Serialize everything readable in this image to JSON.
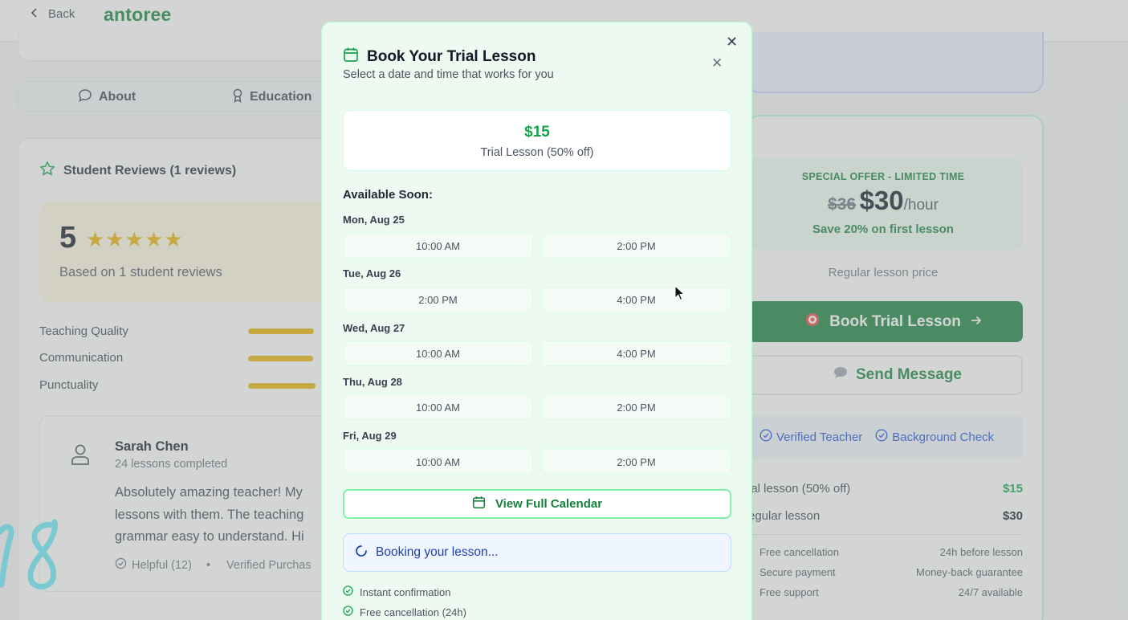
{
  "header": {
    "back_label": "Back",
    "brand": "antoree"
  },
  "tabs": [
    {
      "label": "About"
    },
    {
      "label": "Education"
    }
  ],
  "reviews": {
    "title": "Student Reviews (1 reviews)",
    "rating": "5",
    "stars": 5,
    "based_on": "Based on 1 student reviews",
    "metrics": [
      {
        "label": "Teaching Quality",
        "score_fraction": 1
      },
      {
        "label": "Communication",
        "score_fraction": 1
      },
      {
        "label": "Punctuality",
        "score_fraction": 1
      }
    ],
    "review": {
      "name": "Sarah Chen",
      "lessons": "24 lessons completed",
      "lines": [
        "Absolutely amazing teacher! My",
        "lessons with them. The teaching",
        "grammar easy to understand. Hi"
      ],
      "helpful": "Helpful (12)",
      "bullet": "•",
      "verified": "Verified Purchas"
    }
  },
  "pricing": {
    "offer_label": "SPECIAL OFFER - LIMITED TIME",
    "old_price": "$36",
    "new_price": "$30",
    "per_hour": "/hour",
    "save_text": "Save 20% on first lesson",
    "regular_label": "Regular lesson price",
    "book_label": "Book Trial Lesson",
    "message_label": "Send Message",
    "badges": [
      "Verified Teacher",
      "Background Check"
    ],
    "rows": [
      {
        "label": "ial lesson (50% off)",
        "value": "$15",
        "value_color": "#16a34a"
      },
      {
        "label": "egular lesson",
        "value": "$30",
        "value_color": "#111827"
      }
    ],
    "features": [
      {
        "label": "Free cancellation",
        "value": "24h before lesson"
      },
      {
        "label": "Secure payment",
        "value": "Money-back guarantee"
      },
      {
        "label": "Free support",
        "value": "24/7 available"
      }
    ]
  },
  "modal": {
    "title": "Book Your Trial Lesson",
    "subtitle": "Select a date and time that works for you",
    "price": "$15",
    "price_desc": "Trial Lesson (50% off)",
    "available_title": "Available Soon:",
    "days": [
      {
        "label": "Mon, Aug 25",
        "slots": [
          "10:00 AM",
          "2:00 PM"
        ]
      },
      {
        "label": "Tue, Aug 26",
        "slots": [
          "2:00 PM",
          "4:00 PM"
        ]
      },
      {
        "label": "Wed, Aug 27",
        "slots": [
          "10:00 AM",
          "4:00 PM"
        ]
      },
      {
        "label": "Thu, Aug 28",
        "slots": [
          "10:00 AM",
          "2:00 PM"
        ]
      },
      {
        "label": "Fri, Aug 29",
        "slots": [
          "10:00 AM",
          "2:00 PM"
        ]
      }
    ],
    "view_calendar": "View Full Calendar",
    "booking_status": "Booking your lesson...",
    "notes": [
      "Instant confirmation",
      "Free cancellation (24h)"
    ]
  },
  "scribble_text": "78",
  "colors": {
    "brand_green": "#15803d",
    "price_green": "#16a34a",
    "star_yellow": "#eab308",
    "info_blue": "#1e40af"
  }
}
